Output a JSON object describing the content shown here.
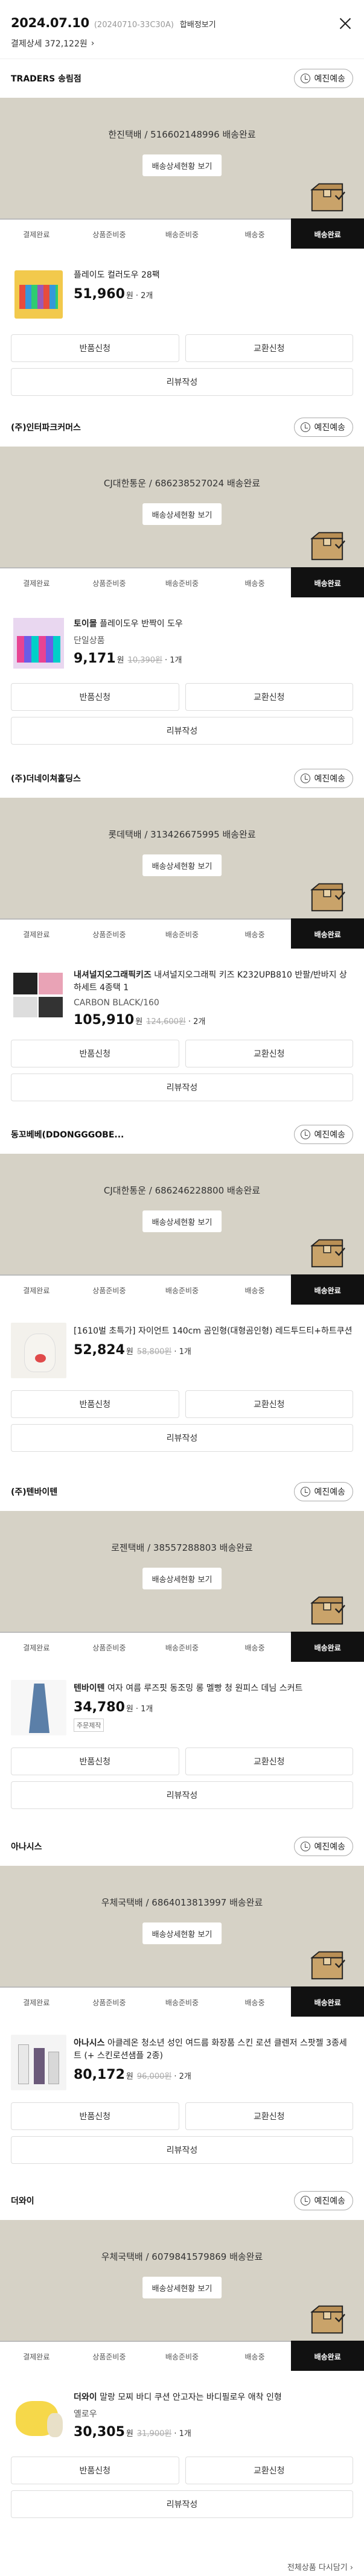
{
  "header": {
    "date": "2024.07.10",
    "order_no": "(20240710-33C30A)",
    "combined_link": "합배정보기",
    "payment": "결제상세 372,122원",
    "payment_chevron": "›"
  },
  "steps": [
    "결제완료",
    "상품준비중",
    "배송준비중",
    "배송중",
    "배송완료"
  ],
  "detail_button": "배송상세현황 보기",
  "schedule_button": "예진예송",
  "actions": {
    "return": "반품신청",
    "exchange": "교환신청",
    "review": "리뷰작성"
  },
  "won": "원",
  "stores": [
    {
      "name": "TRADERS 송림점",
      "banner": "한진택배 / 516602148996 배송완료",
      "product": {
        "brand": "",
        "title": "플레이도 컬러도우 28팩",
        "option": "",
        "price": "51,960",
        "orig": "",
        "qty": "· 2개",
        "tag": ""
      }
    },
    {
      "name": "(주)인터파크커머스",
      "banner": "CJ대한통운 / 686238527024 배송완료",
      "product": {
        "brand": "토이몰",
        "title": "플레이도우 반짝이 도우",
        "option": "단일상품",
        "price": "9,171",
        "orig": "10,390원",
        "qty": "· 1개",
        "tag": ""
      }
    },
    {
      "name": "(주)더네이쳐홀딩스",
      "banner": "롯데택배 / 313426675995 배송완료",
      "product": {
        "brand": "내셔널지오그래픽키즈",
        "title": "내셔널지오그래픽 키즈 K232UPB810 반팔/반바지 상하세트 4종택 1",
        "option": "CARBON BLACK/160",
        "price": "105,910",
        "orig": "124,600원",
        "qty": "· 2개",
        "tag": ""
      }
    },
    {
      "name": "동꼬베베(DDONGGGOBE...",
      "banner": "CJ대한통운 / 686246228800 배송완료",
      "product": {
        "brand": "",
        "title": "[1610벌 초특가] 자이언트 140cm 곰인형(대형곰인형) 레드투드티+하트쿠션",
        "option": "",
        "price": "52,824",
        "orig": "58,800원",
        "qty": "· 1개",
        "tag": ""
      }
    },
    {
      "name": "(주)텐바이텐",
      "banner": "로젠택배 / 38557288803 배송완료",
      "product": {
        "brand": "텐바이텐",
        "title": "여자 여름 루즈핏 동조밍 롱 멜빵 청 원피스 데님 스커트",
        "option": "",
        "price": "34,780",
        "orig": "",
        "qty": "· 1개",
        "tag": "주문제작"
      }
    },
    {
      "name": "아나시스",
      "banner": "우체국택배 / 6864013813997 배송완료",
      "product": {
        "brand": "아나시스",
        "title": "아클레온 청소년 성인 여드름 화장품 스킨 로션 클렌저 스팟젤 3종세트 (+ 스킨로션샘플 2종)",
        "option": "",
        "price": "80,172",
        "orig": "96,000원",
        "qty": "· 2개",
        "tag": ""
      }
    },
    {
      "name": "더와이",
      "banner": "우체국택배 / 6079841579869 배송완료",
      "product": {
        "brand": "더와이",
        "title": "말랑 모찌 바디 쿠션 안고자는 바디필로우 애착 인형",
        "option": "옐로우",
        "price": "30,305",
        "orig": "31,900원",
        "qty": "· 1개",
        "tag": ""
      }
    }
  ],
  "footer": {
    "more": "전체상품 다시담기 ›"
  },
  "colors": {
    "banner": "#d6d2c6",
    "active_step": "#111111"
  }
}
